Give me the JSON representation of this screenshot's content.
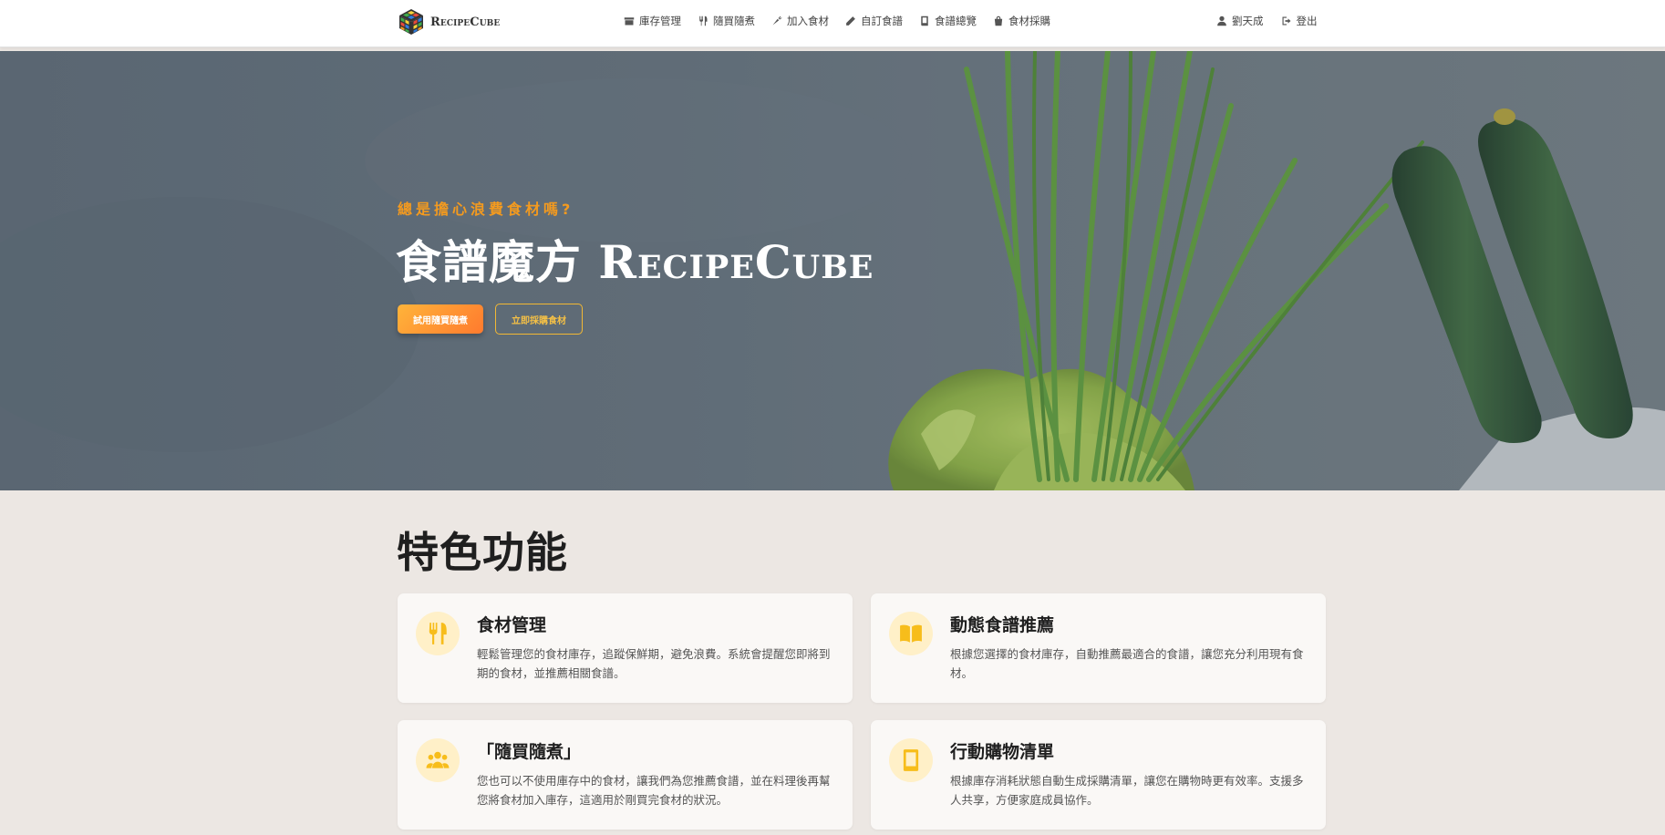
{
  "brand": {
    "name": "RecipeCube"
  },
  "nav": {
    "items": [
      {
        "label": "庫存管理",
        "icon": "box-icon"
      },
      {
        "label": "隨買隨煮",
        "icon": "utensils-icon"
      },
      {
        "label": "加入食材",
        "icon": "carrot-icon"
      },
      {
        "label": "自訂食譜",
        "icon": "pencil-icon"
      },
      {
        "label": "食譜總覽",
        "icon": "book-icon"
      },
      {
        "label": "食材採購",
        "icon": "shopping-bag-icon"
      }
    ],
    "user": {
      "name": "劉天成",
      "icon": "user-icon"
    },
    "logout": {
      "label": "登出",
      "icon": "logout-icon"
    }
  },
  "hero": {
    "eyebrow": "總是擔心浪費食材嗎?",
    "title_cn": "食譜魔方",
    "title_en": "RecipeCube",
    "primary_button": "試用隨買隨煮",
    "secondary_button": "立即採購食材"
  },
  "features": {
    "title": "特色功能",
    "cards": [
      {
        "title": "食材管理",
        "description": "輕鬆管理您的食材庫存，追蹤保鮮期，避免浪費。系統會提醒您即將到期的食材，並推薦相關食譜。",
        "icon": "utensils-icon"
      },
      {
        "title": "動態食譜推薦",
        "description": "根據您選擇的食材庫存，自動推薦最適合的食譜，讓您充分利用現有食材。",
        "icon": "open-book-icon"
      },
      {
        "title": "「隨買隨煮」",
        "description": "您也可以不使用庫存中的食材，讓我們為您推薦食譜，並在料理後再幫您將食材加入庫存，這適用於剛買完食材的狀況。",
        "icon": "users-icon"
      },
      {
        "title": "行動購物清單",
        "description": "根據庫存消耗狀態自動生成採購清單，讓您在購物時更有效率。支援多人共享，方便家庭成員協作。",
        "icon": "mobile-phone-icon"
      }
    ]
  },
  "colors": {
    "accent": "#f39a1f",
    "icon_yellow": "#f7bd1b",
    "hero_overlay": "#5d6a76",
    "page_bg": "#ece7e3"
  }
}
